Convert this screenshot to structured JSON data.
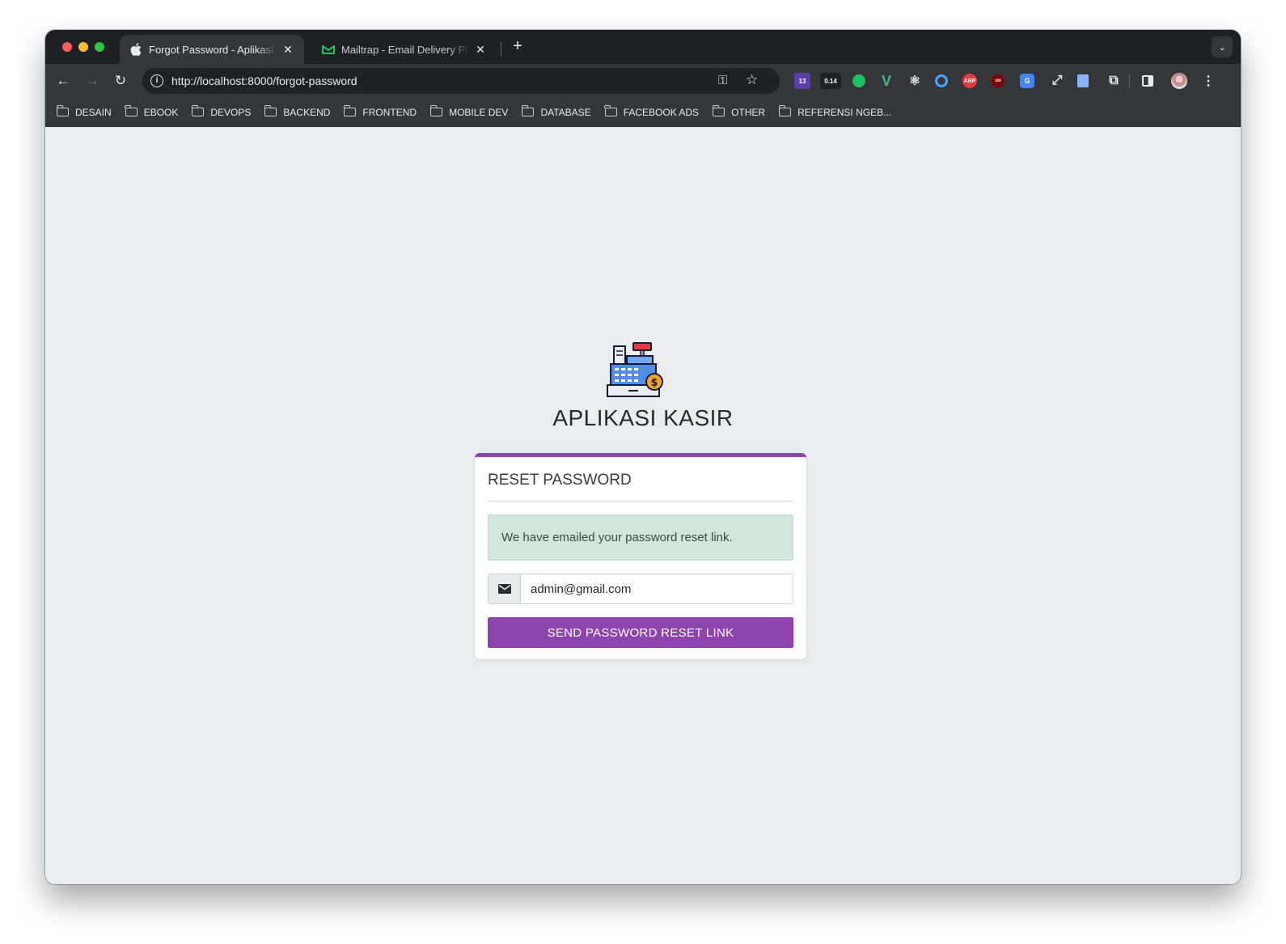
{
  "browser": {
    "tabs": [
      {
        "title": "Forgot Password - Aplikasi Kasir",
        "active": true,
        "icon": "apple-icon"
      },
      {
        "title": "Mailtrap - Email Delivery Platform",
        "active": false,
        "icon": "mailtrap-icon"
      }
    ],
    "new_tab_label": "+",
    "url": "http://localhost:8000/forgot-password",
    "extensions": [
      {
        "name": "ext-13-icon",
        "badge": "13"
      },
      {
        "name": "ext-gauge-icon",
        "badge": "0.14"
      }
    ],
    "bookmarks": [
      "DESAIN",
      "EBOOK",
      "DEVOPS",
      "BACKEND",
      "FRONTEND",
      "MOBILE DEV",
      "DATABASE",
      "FACEBOOK ADS",
      "OTHER",
      "REFERENSI NGEB..."
    ]
  },
  "app": {
    "title": "APLIKASI KASIR"
  },
  "card": {
    "title": "RESET PASSWORD",
    "alert": "We have emailed your password reset link.",
    "email_value": "admin@gmail.com",
    "submit_label": "SEND PASSWORD RESET LINK"
  },
  "colors": {
    "accent": "#8e44ad",
    "alert_bg": "#d1e7dd",
    "page_bg": "#ebecee"
  }
}
